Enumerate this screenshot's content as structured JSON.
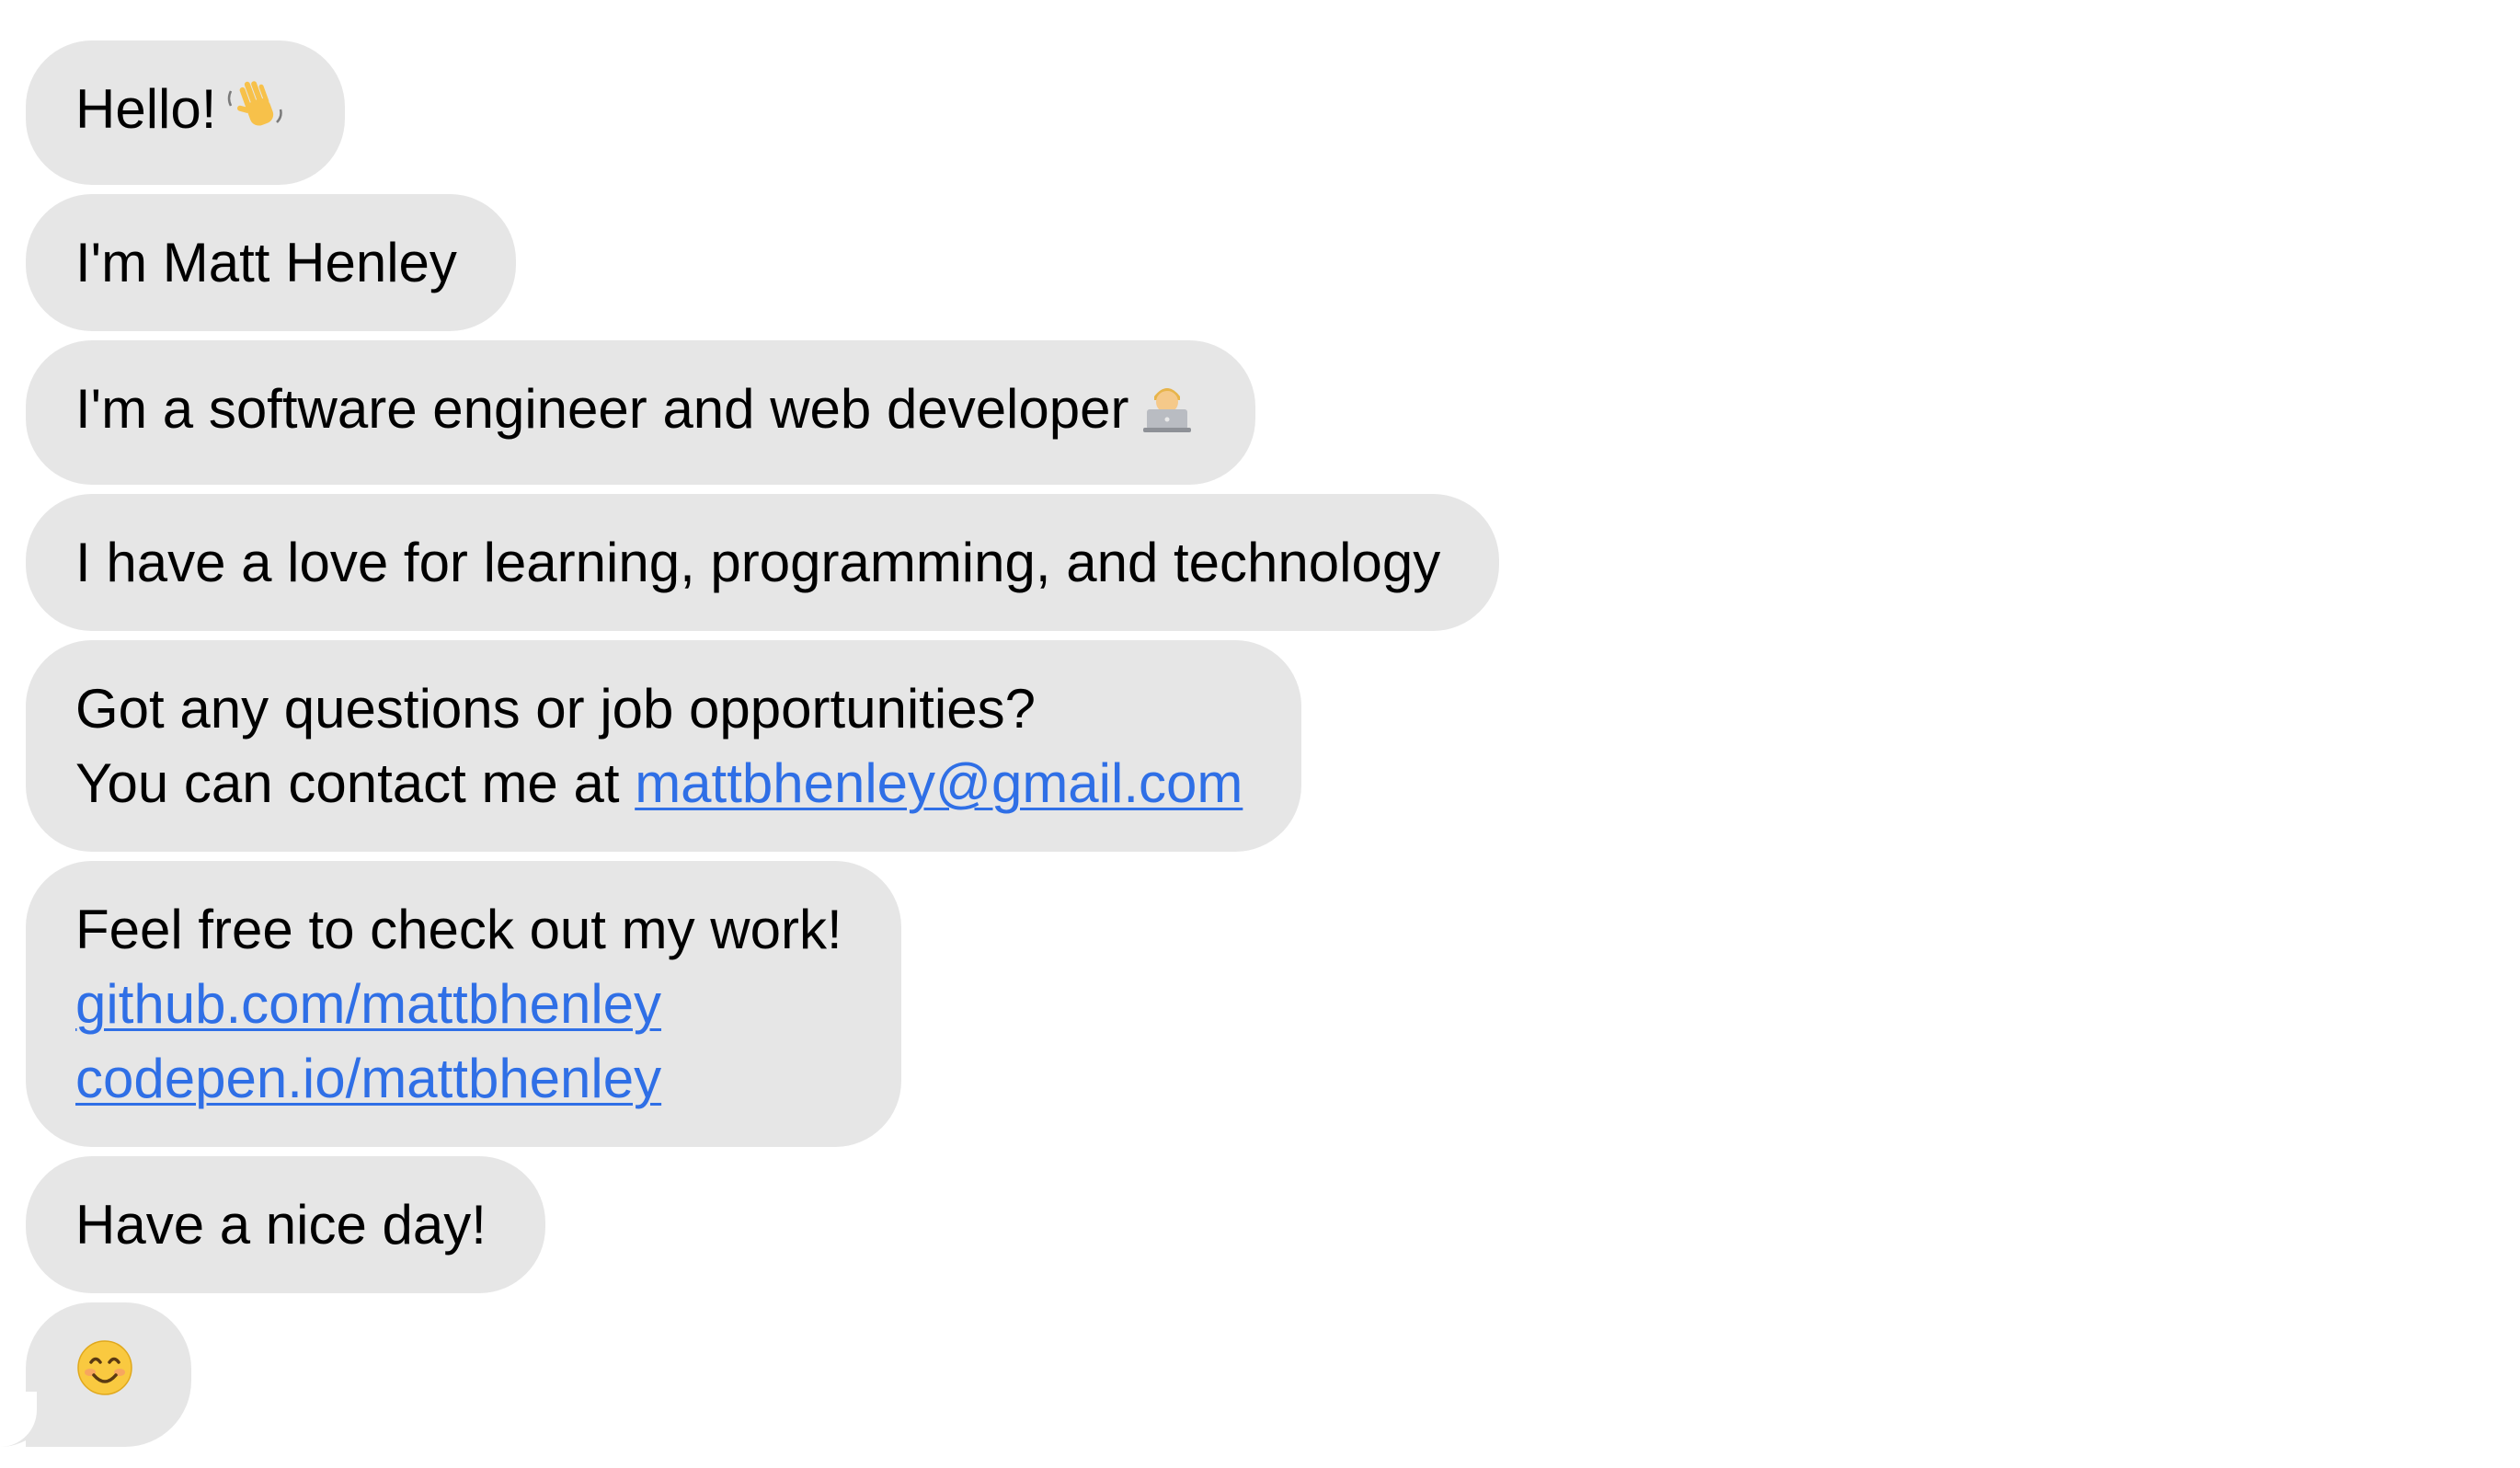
{
  "messages": [
    {
      "text": "Hello!",
      "emoji": "wave-emoji"
    },
    {
      "text": "I'm Matt Henley"
    },
    {
      "text": "I'm a software engineer and web developer",
      "emoji": "technologist-emoji"
    },
    {
      "text": "I have a love for learning, programming, and technology"
    },
    {
      "line1": "Got any questions or job opportunities?",
      "line2_prefix": "You can contact me at ",
      "email": "mattbhenley@gmail.com"
    },
    {
      "line1": "Feel free to check out my work!",
      "github": "github.com/mattbhenley",
      "codepen": "codepen.io/mattbhenley"
    },
    {
      "text": "Have a nice day!"
    },
    {
      "emoji": "smile-emoji"
    }
  ],
  "colors": {
    "bubble": "#e6e6e6",
    "link": "#2f6fe6",
    "text": "#000000"
  }
}
